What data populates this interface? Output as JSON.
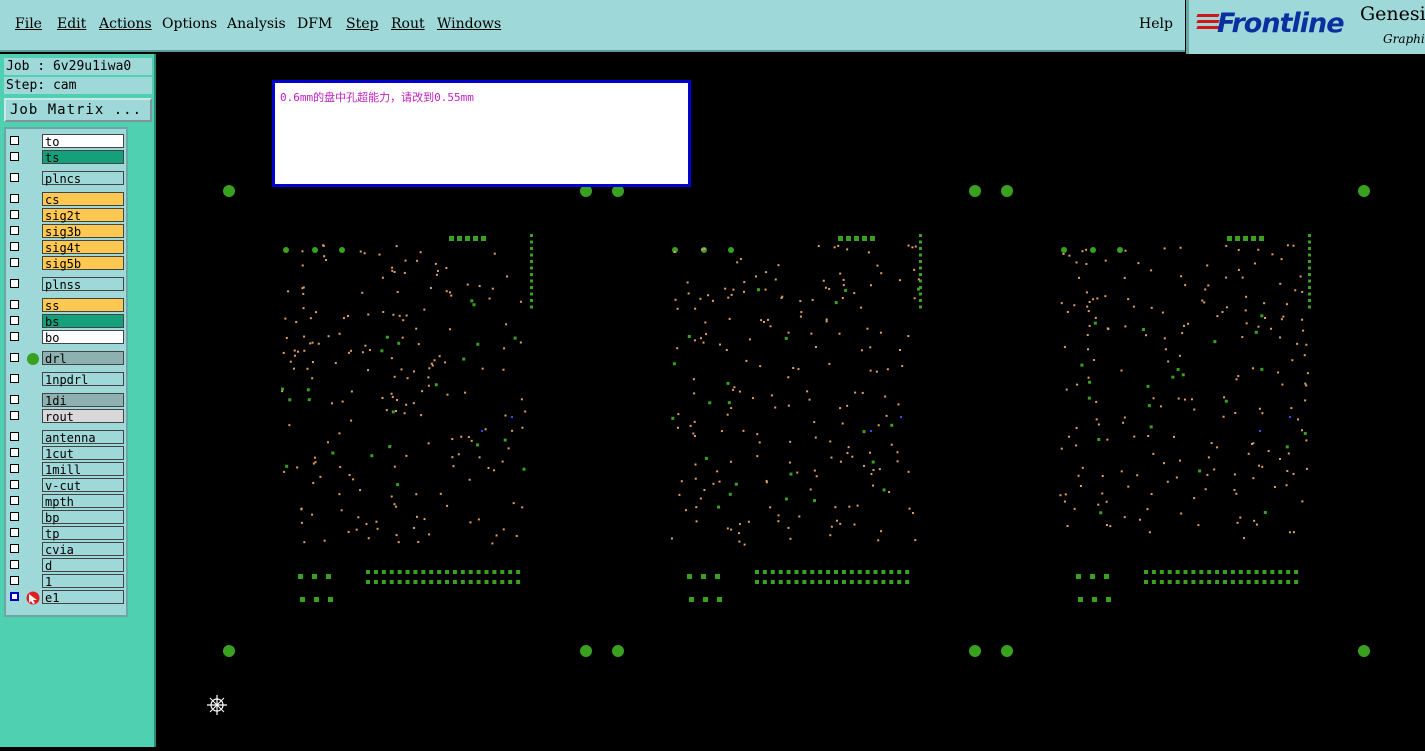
{
  "menu": {
    "file": "File",
    "edit": "Edit",
    "actions": "Actions",
    "options": "Options",
    "analysis": "Analysis",
    "dfm": "DFM",
    "step": "Step",
    "rout": "Rout",
    "windows": "Windows",
    "help": "Help"
  },
  "logo": {
    "brand": "Frontline",
    "product": "Genesi",
    "subtitle": "Graphic"
  },
  "job": {
    "job_label": "Job : 6v29u1iwa0",
    "step_label": "Step: cam",
    "matrix_button": "Job Matrix ..."
  },
  "layers": [
    {
      "name": "to",
      "color": "#ffffff"
    },
    {
      "name": "ts",
      "color": "#14a07a"
    },
    {
      "name": "plncs",
      "color": "#9fd8d8"
    },
    {
      "name": "cs",
      "color": "#ffc850"
    },
    {
      "name": "sig2t",
      "color": "#ffc850"
    },
    {
      "name": "sig3b",
      "color": "#ffc850"
    },
    {
      "name": "sig4t",
      "color": "#ffc850"
    },
    {
      "name": "sig5b",
      "color": "#ffc850"
    },
    {
      "name": "plnss",
      "color": "#9fd8d8"
    },
    {
      "name": "ss",
      "color": "#ffc850"
    },
    {
      "name": "bs",
      "color": "#14a07a"
    },
    {
      "name": "bo",
      "color": "#ffffff"
    },
    {
      "name": "drl",
      "color": "#8fb0b0",
      "mark": "green-dot"
    },
    {
      "name": "1npdrl",
      "color": "#9fd8d8"
    },
    {
      "name": "1di",
      "color": "#8fb0b0"
    },
    {
      "name": "rout",
      "color": "#d8d8d8"
    },
    {
      "name": "antenna",
      "color": "#9fd8d8"
    },
    {
      "name": "1cut",
      "color": "#9fd8d8"
    },
    {
      "name": "1mill",
      "color": "#9fd8d8"
    },
    {
      "name": "v-cut",
      "color": "#9fd8d8"
    },
    {
      "name": "mpth",
      "color": "#9fd8d8"
    },
    {
      "name": "bp",
      "color": "#9fd8d8"
    },
    {
      "name": "tp",
      "color": "#9fd8d8"
    },
    {
      "name": "cvia",
      "color": "#9fd8d8"
    },
    {
      "name": "d",
      "color": "#9fd8d8"
    },
    {
      "name": "1",
      "color": "#9fd8d8"
    },
    {
      "name": "e1",
      "color": "#9fd8d8",
      "mark": "work-layer"
    }
  ],
  "message": "0.6mm的盘中孔超能力，请改到0.55mm",
  "colors": {
    "pad_green": "#3aa020",
    "dot_orange": "#e0a060",
    "via_blue": "#3050ff"
  }
}
